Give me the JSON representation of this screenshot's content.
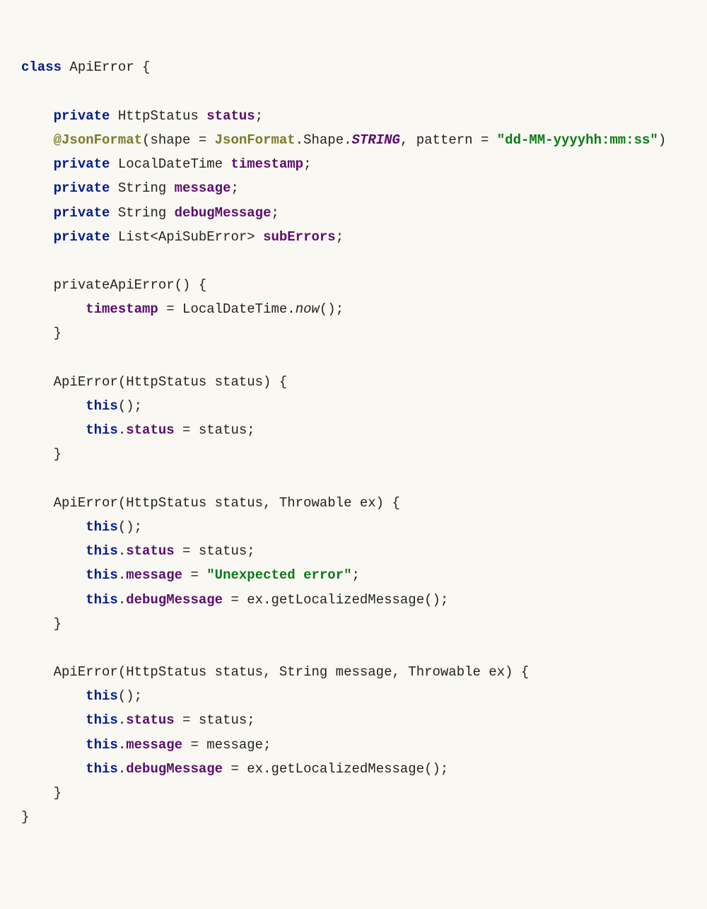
{
  "t": {
    "class": "class",
    "ApiError": "ApiError",
    "ocb": " {",
    "private": "private",
    "HttpStatus": " HttpStatus ",
    "status": "status",
    "semi": ";",
    "atJsonFormat": "@JsonFormat",
    "annotArgs1": "(shape = ",
    "JsonFormat": "JsonFormat",
    "dotShapeDot": ".Shape.",
    "STRING": "STRING",
    "patternEq": ", pattern = ",
    "patternStr": "\"dd-MM-yyyyhh:mm:ss\"",
    "closeParen": ")",
    "LocalDateTime": " LocalDateTime ",
    "timestamp": "timestamp",
    "String": " String ",
    "message": "message",
    "debugMessage": "debugMessage",
    "ListOpen": " List<ApiSubError> ",
    "subErrors": "subErrors",
    "privateApiError": "privateApiError() {",
    "tsAssign": " = LocalDateTime.",
    "now": "now",
    "nowCall": "();",
    "ccb": "}",
    "ctor1": "ApiError(HttpStatus status) {",
    "this": "this",
    "thisCall": "();",
    "eqStatus": " = status;",
    "ctor2": "ApiError(HttpStatus status, Throwable ex) {",
    "eq": " = ",
    "unexpected": "\"Unexpected error\"",
    "eqExLocal": " = ex.getLocalizedMessage();",
    "ctor3": "ApiError(HttpStatus status, String message, Throwable ex) {",
    "eqMessage": " = message;",
    "dot": "."
  }
}
